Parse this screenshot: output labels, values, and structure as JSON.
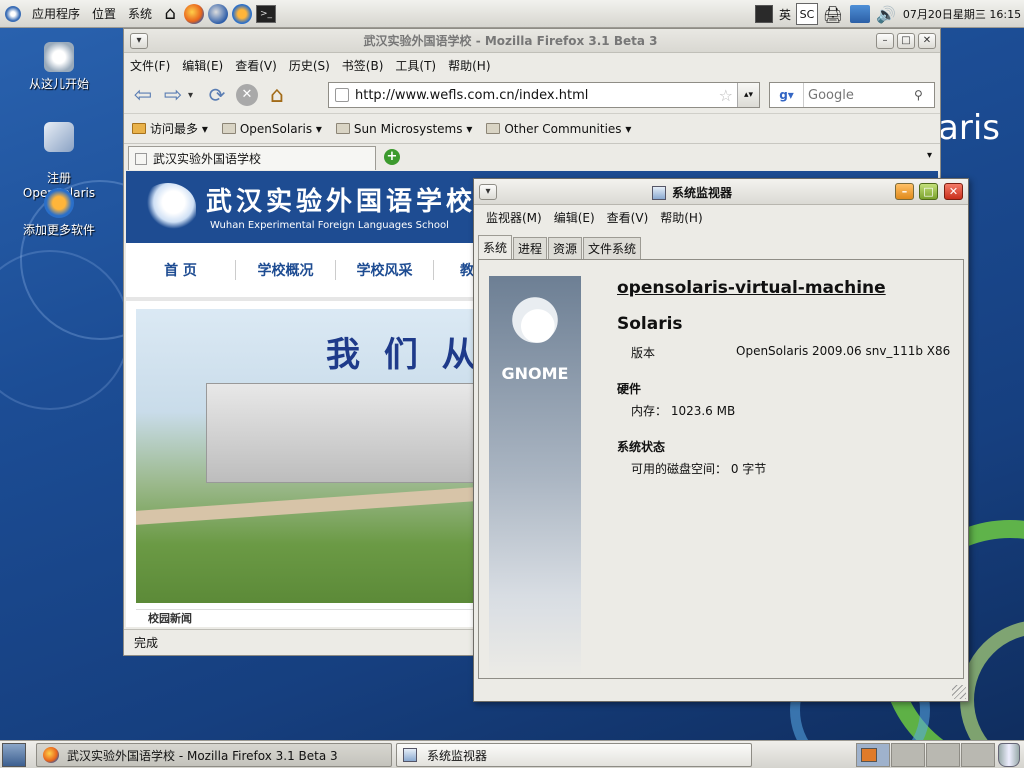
{
  "top_panel": {
    "menus": [
      "应用程序",
      "位置",
      "系统"
    ],
    "input_lang": "英",
    "input_mode": "SC",
    "clock": "07月20日星期三 16:15"
  },
  "desktop": {
    "icons": [
      {
        "label": "从这儿开始"
      },
      {
        "label": "注册\nOpenSolaris"
      },
      {
        "label": "添加更多软件"
      }
    ],
    "brand_text": "aris"
  },
  "firefox": {
    "title": "武汉实验外国语学校 - Mozilla Firefox 3.1 Beta 3",
    "menu": [
      "文件(F)",
      "编辑(E)",
      "查看(V)",
      "历史(S)",
      "书签(B)",
      "工具(T)",
      "帮助(H)"
    ],
    "url": "http://www.wefls.com.cn/index.html",
    "search_placeholder": "Google",
    "bookmarks": [
      "访问最多",
      "OpenSolaris",
      "Sun Microsystems",
      "Other Communities"
    ],
    "tab_label": "武汉实验外国语学校",
    "status": "完成",
    "site": {
      "name_cn": "武汉实验外国语学校",
      "name_en": "Wuhan Experimental Foreign Languages School",
      "nav": [
        "首 页",
        "学校概况",
        "学校风采",
        "教育"
      ],
      "banner_text": "我 们 从",
      "news_heading": "校园新闻"
    }
  },
  "sysmon": {
    "title": "系统监视器",
    "menu": [
      "监视器(M)",
      "编辑(E)",
      "查看(V)",
      "帮助(H)"
    ],
    "tabs": [
      "系统",
      "进程",
      "资源",
      "文件系统"
    ],
    "hostname": "opensolaris-virtual-machine",
    "os_name": "Solaris",
    "version_label": "版本",
    "version_value": "OpenSolaris 2009.06 snv_111b X86",
    "hardware_heading": "硬件",
    "memory_line": "内存： 1023.6 MB",
    "status_heading": "系统状态",
    "disk_line": "可用的磁盘空间： 0 字节",
    "gnome_logo_text": "GNOME"
  },
  "taskbar": {
    "tasks": [
      "武汉实验外国语学校 - Mozilla Firefox 3.1 Beta 3",
      "系统监视器"
    ]
  }
}
